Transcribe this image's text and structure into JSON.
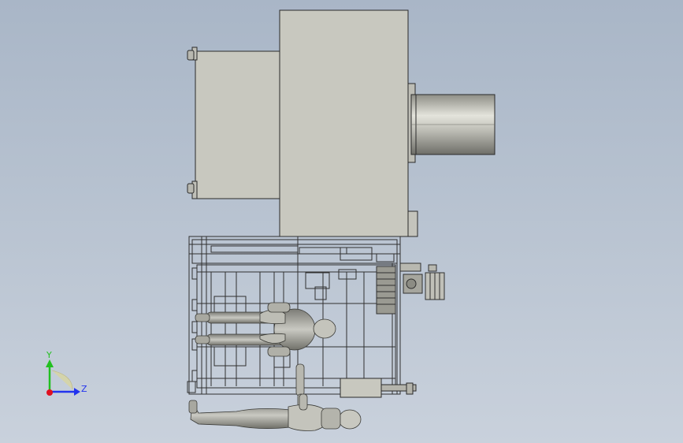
{
  "viewport": {
    "background_top": "#a9b6c7",
    "background_bottom": "#c9d1dc"
  },
  "triad": {
    "y_label": "Y",
    "z_label": "Z",
    "y_color": "#22c020",
    "z_color": "#2233ee",
    "x_color": "#e01020"
  },
  "colors": {
    "housing_fill": "#c8c8bf",
    "housing_stroke": "#2a2a2a",
    "frame_stroke": "#303030",
    "figure_fill": "#a4a49c"
  }
}
